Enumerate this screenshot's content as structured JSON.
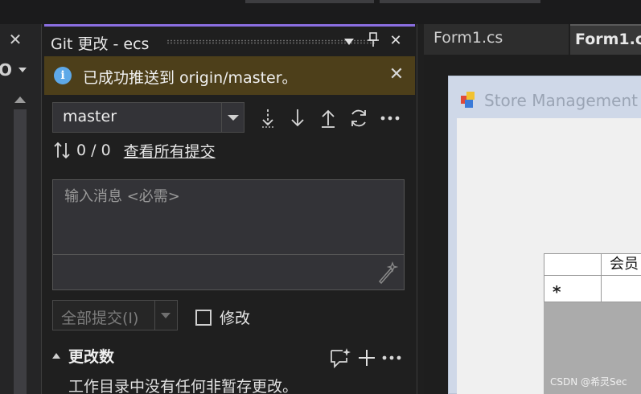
{
  "left_panel": {
    "close_glyph": "✕",
    "search_glyph": "O"
  },
  "git_panel": {
    "title": "Git 更改 - ecs",
    "header_buttons": {
      "dropdown": "▾",
      "pin": "⊣",
      "close": "✕"
    },
    "banner": {
      "icon": "i",
      "message": "已成功推送到 origin/master。",
      "close": "✕",
      "color": "#4d3f1a"
    },
    "branch": {
      "value": "master"
    },
    "counts": {
      "text": "0 / 0",
      "link": "查看所有提交"
    },
    "commit_message": {
      "placeholder": "输入消息 <必需>"
    },
    "commit_all": {
      "label": "全部提交(I)"
    },
    "amend": {
      "label": "修改"
    },
    "changes": {
      "title": "更改数",
      "empty": "工作目录中没有任何非暂存更改。"
    },
    "accent": "#8a6ee0"
  },
  "editor": {
    "tabs": [
      {
        "label": "Form1.cs"
      },
      {
        "label": "Form1.cs"
      }
    ],
    "form_title": "Store Management",
    "grid": {
      "header": "会员",
      "new_row_marker": "*"
    }
  },
  "watermark": "CSDN @希灵Sec"
}
